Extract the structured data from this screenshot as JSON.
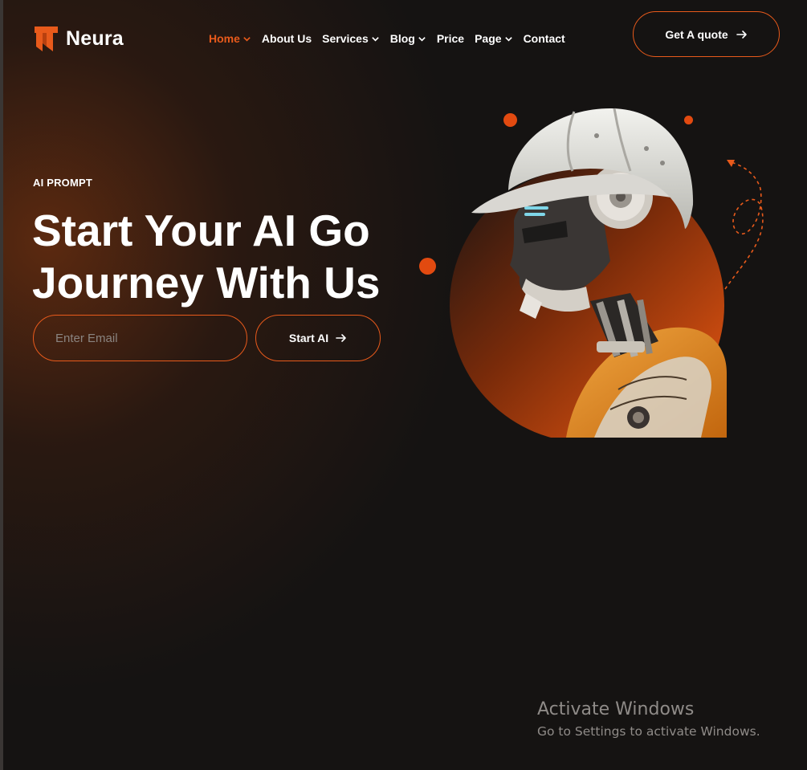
{
  "brand": {
    "name": "Neura",
    "accent": "#e85a1b",
    "icon": "neura-logo-icon"
  },
  "nav": {
    "items": [
      {
        "label": "Home",
        "active": true,
        "dropdown": true
      },
      {
        "label": "About Us",
        "active": false,
        "dropdown": false
      },
      {
        "label": "Services",
        "active": false,
        "dropdown": true
      },
      {
        "label": "Blog",
        "active": false,
        "dropdown": true
      },
      {
        "label": "Price",
        "active": false,
        "dropdown": false
      },
      {
        "label": "Page",
        "active": false,
        "dropdown": true
      },
      {
        "label": "Contact",
        "active": false,
        "dropdown": false
      }
    ],
    "cta_label": "Get A quote"
  },
  "hero": {
    "eyebrow": "AI PROMPT",
    "title_line1": "Start Your AI Go",
    "title_line2": "Journey With Us",
    "email_placeholder": "Enter Email",
    "email_value": "",
    "submit_label": "Start AI",
    "image": "robot-with-hard-hat-image"
  },
  "watermark": {
    "title": "Activate Windows",
    "subtitle": "Go to Settings to activate Windows."
  }
}
